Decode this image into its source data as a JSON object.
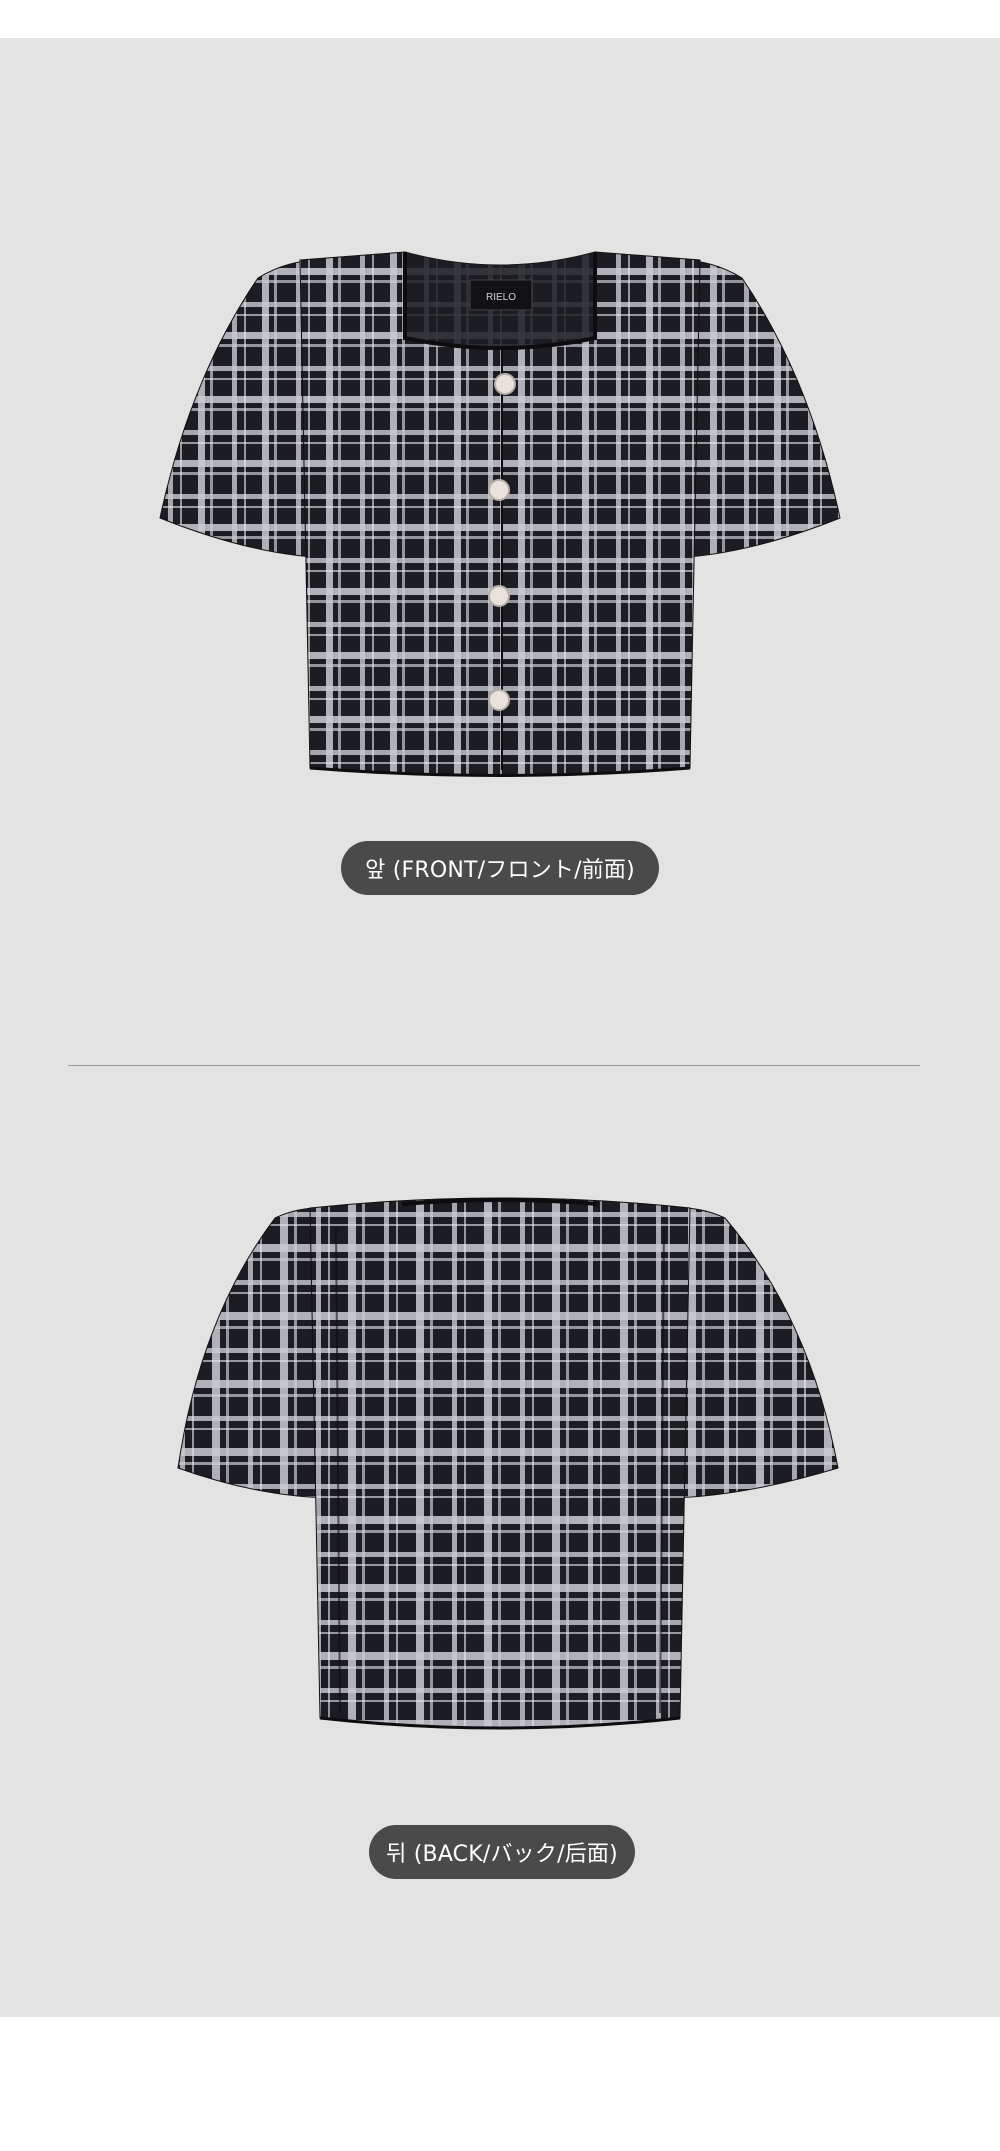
{
  "colors": {
    "background": "#e3e3e3",
    "pill": "#4a4a4a",
    "divider": "#9a9a9a",
    "fabric_dark": "#1c1d22",
    "fabric_light": "#c9cad2"
  },
  "front": {
    "label": "앞 (FRONT/フロント/前面)",
    "brand_tag": "RIELO"
  },
  "back": {
    "label": "뒤 (BACK/バック/后面)"
  }
}
